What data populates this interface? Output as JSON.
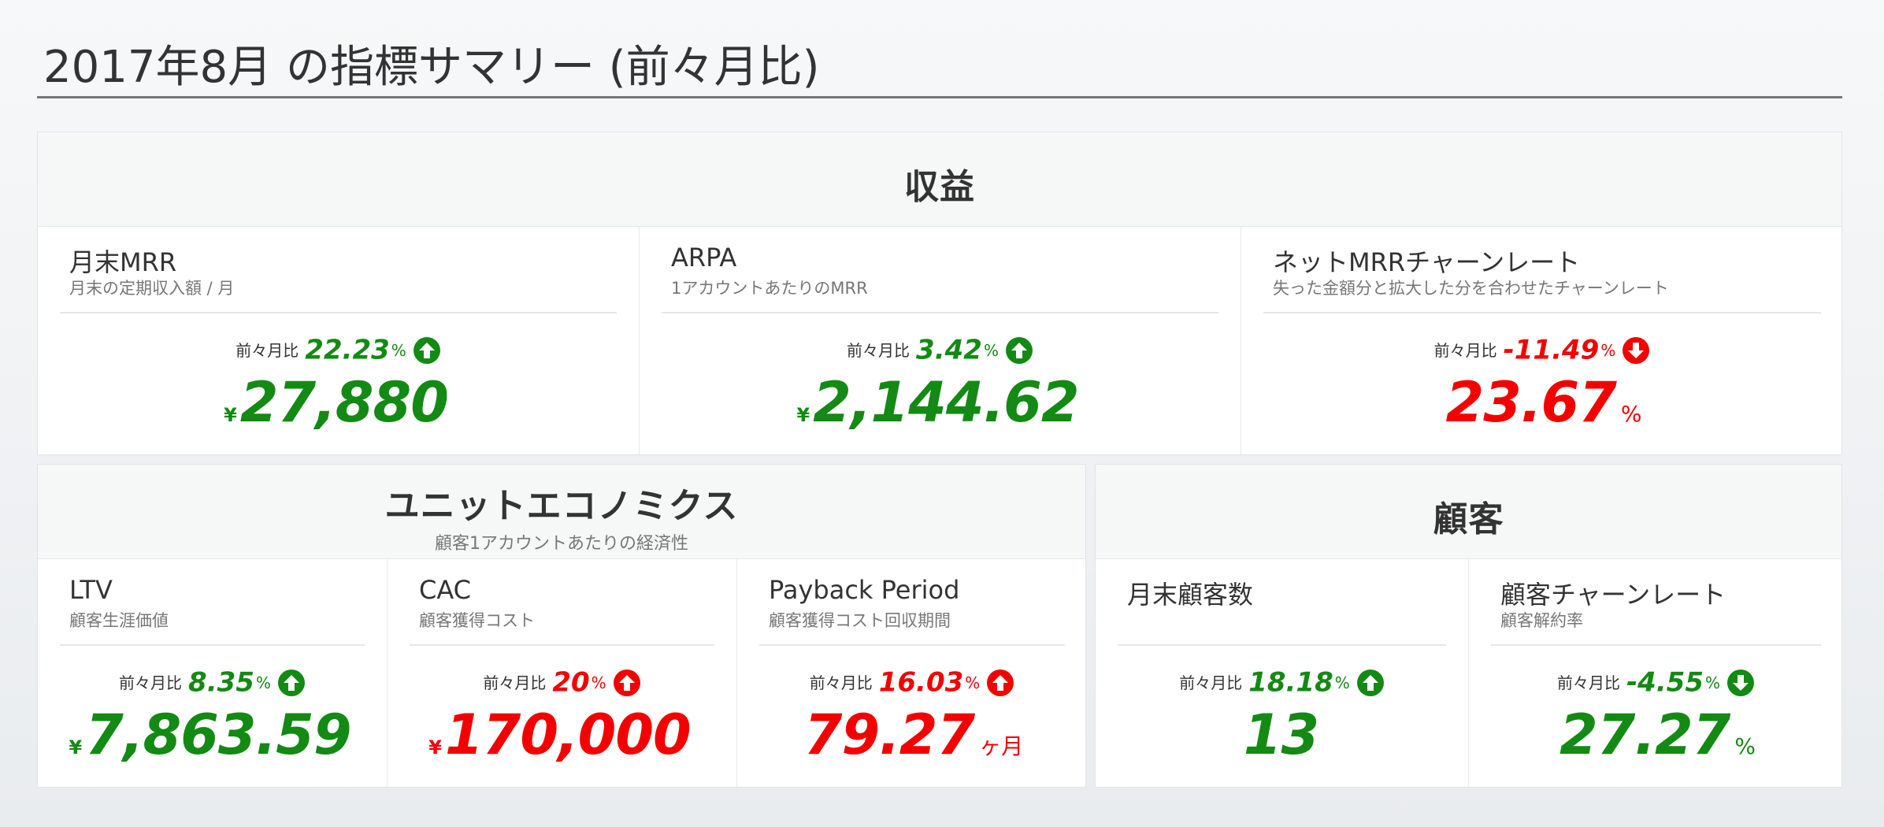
{
  "page_title": "2017年8月 の指標サマリー (前々月比)",
  "colors": {
    "positive": "#138a13",
    "negative": "#f30000",
    "background": "#f0f2f4",
    "panel_header": "#f6f7f7"
  },
  "panels": {
    "revenue": {
      "title": "収益",
      "cards": [
        {
          "title": "月末MRR",
          "desc": "月末の定期収入額 / 月",
          "delta_label": "前々月比",
          "delta_value": "22.23",
          "delta_unit": "%",
          "delta_icon": "arrow-up-circle-icon",
          "prefix": "¥",
          "value": "27,880",
          "suffix": "",
          "status": "positive"
        },
        {
          "title": "ARPA",
          "desc": "1アカウントあたりのMRR",
          "delta_label": "前々月比",
          "delta_value": "3.42",
          "delta_unit": "%",
          "delta_icon": "arrow-up-circle-icon",
          "prefix": "¥",
          "value": "2,144.62",
          "suffix": "",
          "status": "positive"
        },
        {
          "title": "ネットMRRチャーンレート",
          "desc": "失った金額分と拡大した分を合わせたチャーンレート",
          "delta_label": "前々月比",
          "delta_value": "-11.49",
          "delta_unit": "%",
          "delta_icon": "arrow-down-circle-icon",
          "prefix": "",
          "value": "23.67",
          "suffix": "%",
          "status": "negative"
        }
      ]
    },
    "unit_economics": {
      "title": "ユニットエコノミクス",
      "subtitle": "顧客1アカウントあたりの経済性",
      "cards": [
        {
          "title": "LTV",
          "desc": "顧客生涯価値",
          "delta_label": "前々月比",
          "delta_value": "8.35",
          "delta_unit": "%",
          "delta_icon": "arrow-up-circle-icon",
          "prefix": "¥",
          "value": "7,863.59",
          "suffix": "",
          "status": "positive"
        },
        {
          "title": "CAC",
          "desc": "顧客獲得コスト",
          "delta_label": "前々月比",
          "delta_value": "20",
          "delta_unit": "%",
          "delta_icon": "arrow-up-circle-icon",
          "prefix": "¥",
          "value": "170,000",
          "suffix": "",
          "status": "negative"
        },
        {
          "title": "Payback Period",
          "desc": "顧客獲得コスト回収期間",
          "delta_label": "前々月比",
          "delta_value": "16.03",
          "delta_unit": "%",
          "delta_icon": "arrow-up-circle-icon",
          "prefix": "",
          "value": "79.27",
          "suffix": "ヶ月",
          "status": "negative"
        }
      ]
    },
    "customers": {
      "title": "顧客",
      "cards": [
        {
          "title": "月末顧客数",
          "desc": "",
          "delta_label": "前々月比",
          "delta_value": "18.18",
          "delta_unit": "%",
          "delta_icon": "arrow-up-circle-icon",
          "prefix": "",
          "value": "13",
          "suffix": "",
          "status": "positive"
        },
        {
          "title": "顧客チャーンレート",
          "desc": "顧客解約率",
          "delta_label": "前々月比",
          "delta_value": "-4.55",
          "delta_unit": "%",
          "delta_icon": "arrow-down-circle-icon",
          "prefix": "",
          "value": "27.27",
          "suffix": "%",
          "status": "positive"
        }
      ]
    }
  }
}
